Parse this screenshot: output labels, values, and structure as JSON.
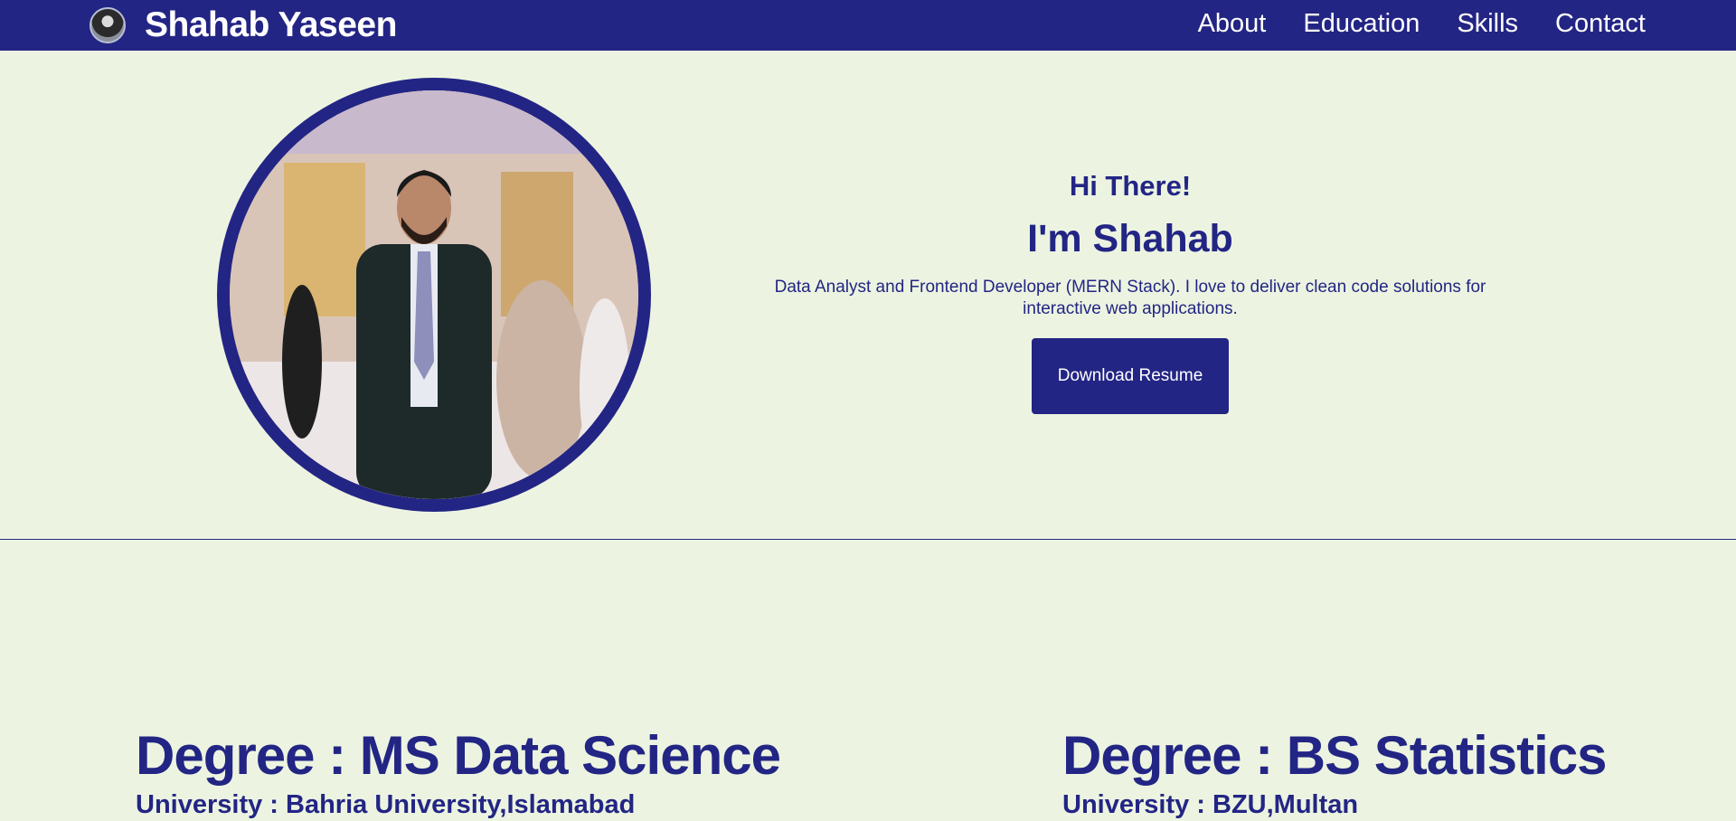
{
  "navbar": {
    "brand_name": "Shahab Yaseen",
    "links": [
      "About",
      "Education",
      "Skills",
      "Contact"
    ]
  },
  "hero": {
    "greeting": "Hi There!",
    "name_line": "I'm Shahab",
    "tagline": "Data Analyst and Frontend Developer (MERN Stack). I love to deliver clean code solutions for interactive web applications.",
    "resume_button": "Download Resume"
  },
  "education": [
    {
      "degree": "Degree : MS Data Science",
      "university": "University : Bahria University,Islamabad"
    },
    {
      "degree": "Degree : BS Statistics",
      "university": "University : BZU,Multan"
    }
  ],
  "colors": {
    "primary": "#232584",
    "background": "#ecf4e1",
    "nav_text": "#ffffff"
  },
  "icons": {
    "brand": "profile-avatar-icon"
  }
}
